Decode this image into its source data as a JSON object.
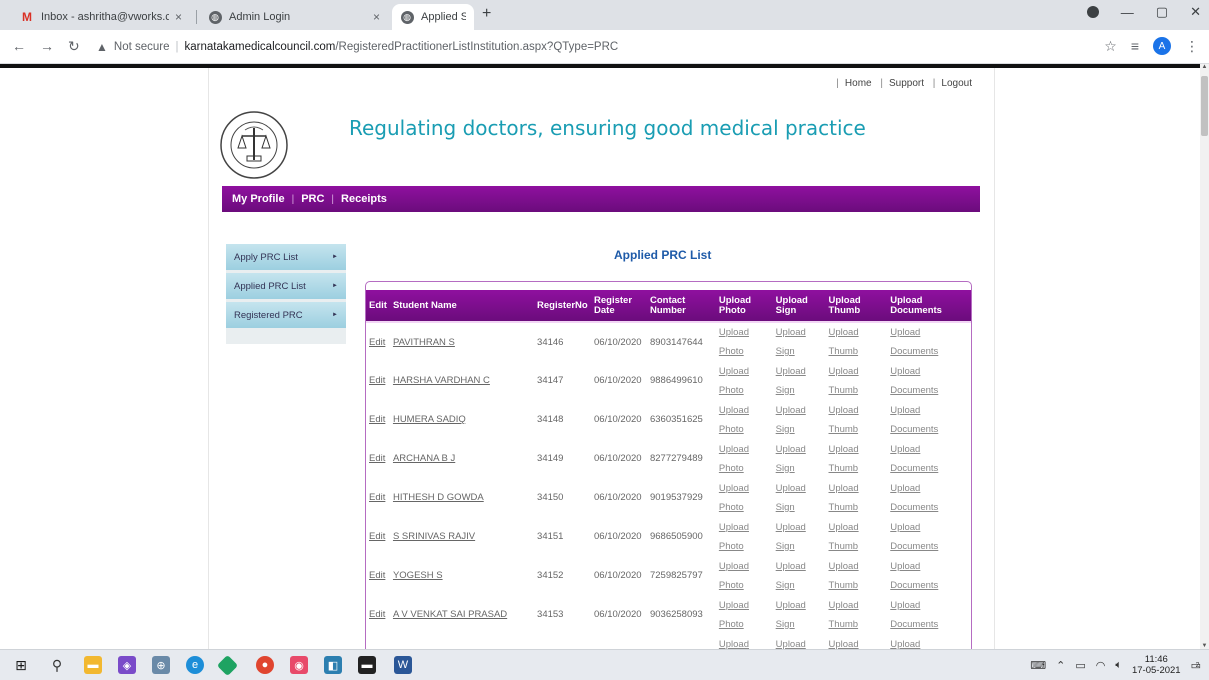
{
  "browser": {
    "tabs": [
      {
        "title": "Inbox - ashritha@vworks.co.in - ",
        "icon": "gmail-icon",
        "close": "×",
        "active": false
      },
      {
        "title": "Admin Login",
        "icon": "globe-icon",
        "close": "×",
        "active": false
      },
      {
        "title": "Applied Student List",
        "icon": "globe-icon",
        "close": "×",
        "active": true
      }
    ],
    "new_tab": "+",
    "omnibox": {
      "security_label": "Not secure",
      "url_host": "karnatakamedicalcouncil.com",
      "url_path": "/RegisteredPractitionerListInstitution.aspx?QType=PRC"
    },
    "profile_initial": "A"
  },
  "header": {
    "links": [
      "Home",
      "Support",
      "Logout"
    ],
    "tagline": "Regulating doctors, ensuring good medical practice"
  },
  "nav": {
    "items": [
      "My Profile",
      "PRC",
      "Receipts"
    ]
  },
  "sidebar": {
    "items": [
      {
        "label": "Apply PRC List"
      },
      {
        "label": "Applied PRC List"
      },
      {
        "label": "Registered PRC"
      }
    ]
  },
  "list": {
    "title": "Applied PRC List",
    "columns": [
      "Edit",
      "Student Name",
      "RegisterNo",
      "Register Date",
      "Contact Number",
      "Upload Photo",
      "Upload Sign",
      "Upload Thumb",
      "Upload Documents"
    ],
    "edit_label": "Edit",
    "upload_labels": {
      "photo": [
        "Upload",
        "Photo"
      ],
      "sign": [
        "Upload",
        "Sign"
      ],
      "thumb": [
        "Upload",
        "Thumb"
      ],
      "documents": [
        "Upload",
        "Documents"
      ]
    },
    "rows": [
      {
        "name": "PAVITHRAN S",
        "reg_no": "34146",
        "date": "06/10/2020",
        "contact": "8903147644"
      },
      {
        "name": "HARSHA VARDHAN C",
        "reg_no": "34147",
        "date": "06/10/2020",
        "contact": "9886499610"
      },
      {
        "name": "HUMERA SADIQ",
        "reg_no": "34148",
        "date": "06/10/2020",
        "contact": "6360351625"
      },
      {
        "name": "ARCHANA B J",
        "reg_no": "34149",
        "date": "06/10/2020",
        "contact": "8277279489"
      },
      {
        "name": "HITHESH D GOWDA",
        "reg_no": "34150",
        "date": "06/10/2020",
        "contact": "9019537929"
      },
      {
        "name": "S SRINIVAS RAJIV",
        "reg_no": "34151",
        "date": "06/10/2020",
        "contact": "9686505900"
      },
      {
        "name": "YOGESH S",
        "reg_no": "34152",
        "date": "06/10/2020",
        "contact": "7259825797"
      },
      {
        "name": "A V VENKAT SAI PRASAD",
        "reg_no": "34153",
        "date": "06/10/2020",
        "contact": "9036258093"
      },
      {
        "name": "",
        "reg_no": "",
        "date": "",
        "contact": ""
      }
    ]
  },
  "taskbar": {
    "time": "11:46",
    "date": "17-05-2021",
    "notification_count": "2"
  }
}
